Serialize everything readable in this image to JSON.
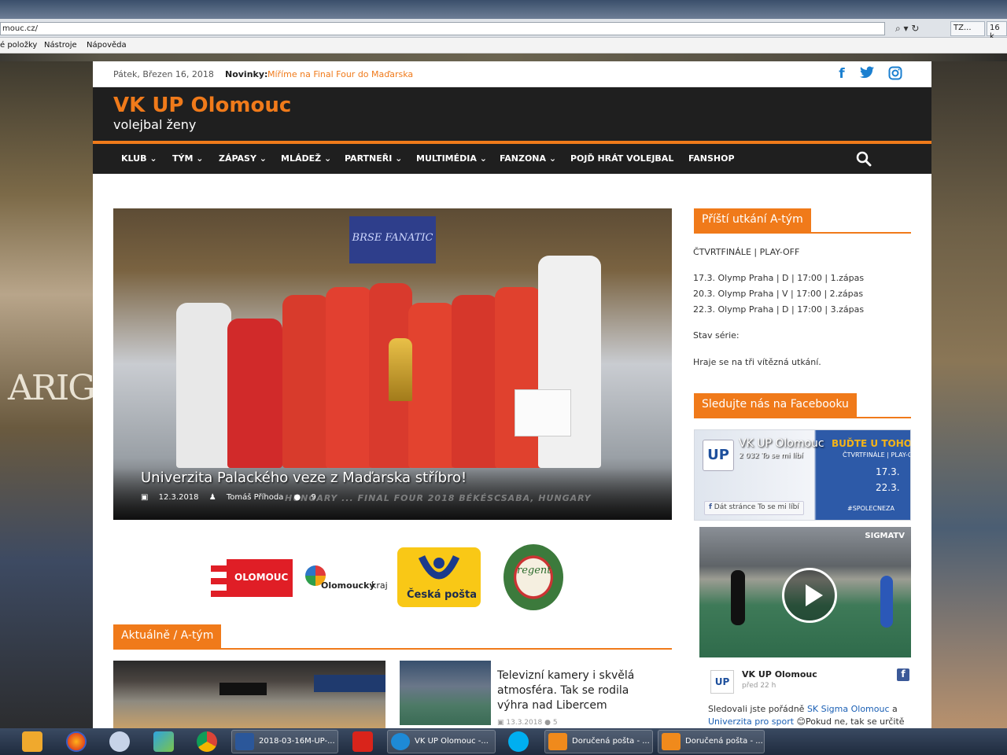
{
  "browser": {
    "url": "mouc.cz/",
    "tab1": "TZ...",
    "tab2": "16 k",
    "menu": [
      "é položky",
      "Nástroje",
      "Nápověda"
    ]
  },
  "topbar": {
    "date": "Pátek, Březen 16, 2018",
    "news_label": "Novinky:",
    "news_text": "Míříme na Final Four do Maďarska"
  },
  "header": {
    "site_title": "VK UP Olomouc",
    "tagline": "volejbal ženy"
  },
  "nav": {
    "items": [
      "KLUB",
      "TÝM",
      "ZÁPASY",
      "MLÁDEŽ",
      "PARTNEŘI",
      "MULTIMÉDIA",
      "FANZONA",
      "POJĎ HRÁT VOLEJBAL",
      "FANSHOP"
    ]
  },
  "hero": {
    "banner": "BRSE FANATIC",
    "title": "Univerzita Palackého veze z Maďarska stříbro!",
    "date": "12.3.2018",
    "author": "Tomáš Příhoda",
    "comments": "9",
    "bottom_text": "HUNGARY ... FINAL FOUR 2018 BÉKÉSCSABA, HUNGARY"
  },
  "sponsors": {
    "olomouc": "OLOMOUC",
    "kraj_a": "Olomoucký",
    "kraj_b": "kraj",
    "posta": "Česká pošta",
    "regent": "regent"
  },
  "section_news": {
    "label": "Aktuálně / A-tým"
  },
  "articles": [
    {
      "title": "Televizní kamery i skvělá atmosféra. Tak se rodila výhra nad Libercem",
      "date": "13.3.2018",
      "comments": "5"
    }
  ],
  "sidebar": {
    "next_match_label": "Příští utkání A-tým",
    "phase": "ČTVRTFINÁLE | PLAY-OFF",
    "matches": [
      "17.3. Olymp Praha | D | 17:00 | 1.zápas",
      "20.3. Olymp Praha | V | 17:00 | 2.zápas",
      "22.3. Olymp Praha | D | 17:00 | 3.zápas"
    ],
    "series_state": "Stav série:",
    "series_note": "Hraje se na tři vítězná utkání.",
    "facebook_label": "Sledujte nás na Facebooku",
    "fb_page_name": "VK UP Olomouc",
    "fb_likes": "2 032 To se mi líbí",
    "fb_like_button": "Dát stránce To se mi líbí",
    "fb_banner_top": "BUĎTE U TOHO S N",
    "fb_banner_sub": "ČTVRTFINÁLE | PLAY-O",
    "fb_date1": "17.3.",
    "fb_date2": "22.3.",
    "fb_hashtag": "#SPOLECNEZA",
    "video_brand": "SIGMATV",
    "post_name": "VK UP Olomouc",
    "post_time": "před 22 h",
    "post_text_a": "Sledovali jste pořádně ",
    "post_link1": "SK Sigma Olomouc",
    "post_text_b": " a",
    "post_link2": "Univerzita pro sport",
    "post_text_c": " 😊Pokud ne, tak se určitě"
  },
  "taskbar": {
    "word": "2018-03-16M-UP-...",
    "ie": "VK UP Olomouc -...",
    "outlook1": "Doručená pošta - ...",
    "outlook2": "Doručená pošta - ..."
  },
  "colors": {
    "accent": "#f07a1a",
    "dark": "#1f1f1f",
    "link": "#1a5fb4"
  }
}
